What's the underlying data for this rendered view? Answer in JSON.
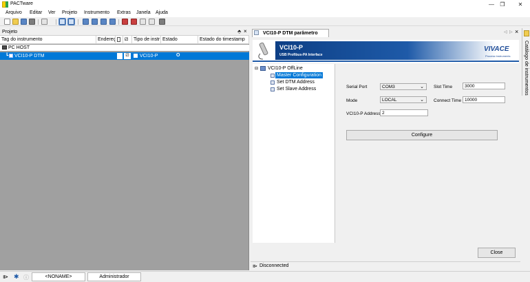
{
  "window": {
    "title": "PACTware",
    "minimize": "—",
    "maximize": "❒",
    "close": "✕"
  },
  "menu": [
    "Arquivo",
    "Editar",
    "Ver",
    "Projeto",
    "Instrumento",
    "Extras",
    "Janela",
    "Ajuda"
  ],
  "project": {
    "title": "Projeto",
    "pin": "⬘",
    "close": "×",
    "columns": [
      "Tag do instrumento",
      "Endereço",
      "Tipo de instr",
      "Estado",
      "Estado do timestamp"
    ],
    "rows": [
      {
        "tag": "PC HOST"
      },
      {
        "tag": "VCI10-P DTM",
        "type": "VCI10-P",
        "state": "O"
      }
    ]
  },
  "dtm": {
    "tab": "VCI10-P DTM parâmetro",
    "nav_prev": "◁",
    "nav_next": "▷",
    "close": "×",
    "banner": {
      "product": "VCI10-P",
      "subtitle": "USB Profibus-PA Interface",
      "brand": "VIVACE",
      "brand_tag": "Process Instruments"
    },
    "tree": {
      "root": "VCI10-P OffLine",
      "items": [
        "Master Configuration",
        "Set DTM Address",
        "Set Slave Address"
      ],
      "selected": "Master Configuration"
    },
    "form": {
      "serial_port_label": "Serial Port",
      "serial_port_value": "COM3",
      "mode_label": "Mode",
      "mode_value": "LOCAL",
      "address_label": "VCI10-P Address",
      "address_value": "2",
      "slot_time_label": "Slot Time",
      "slot_time_value": "3000",
      "connect_time_label": "Connect Time",
      "connect_time_value": "10000",
      "configure_label": "Configure",
      "close_label": "Close"
    },
    "status": "Disconnected"
  },
  "catalog": {
    "label": "Catálogo de instrumentos"
  },
  "bottom": {
    "project_name": "<NONAME>",
    "user": "Administrador"
  }
}
